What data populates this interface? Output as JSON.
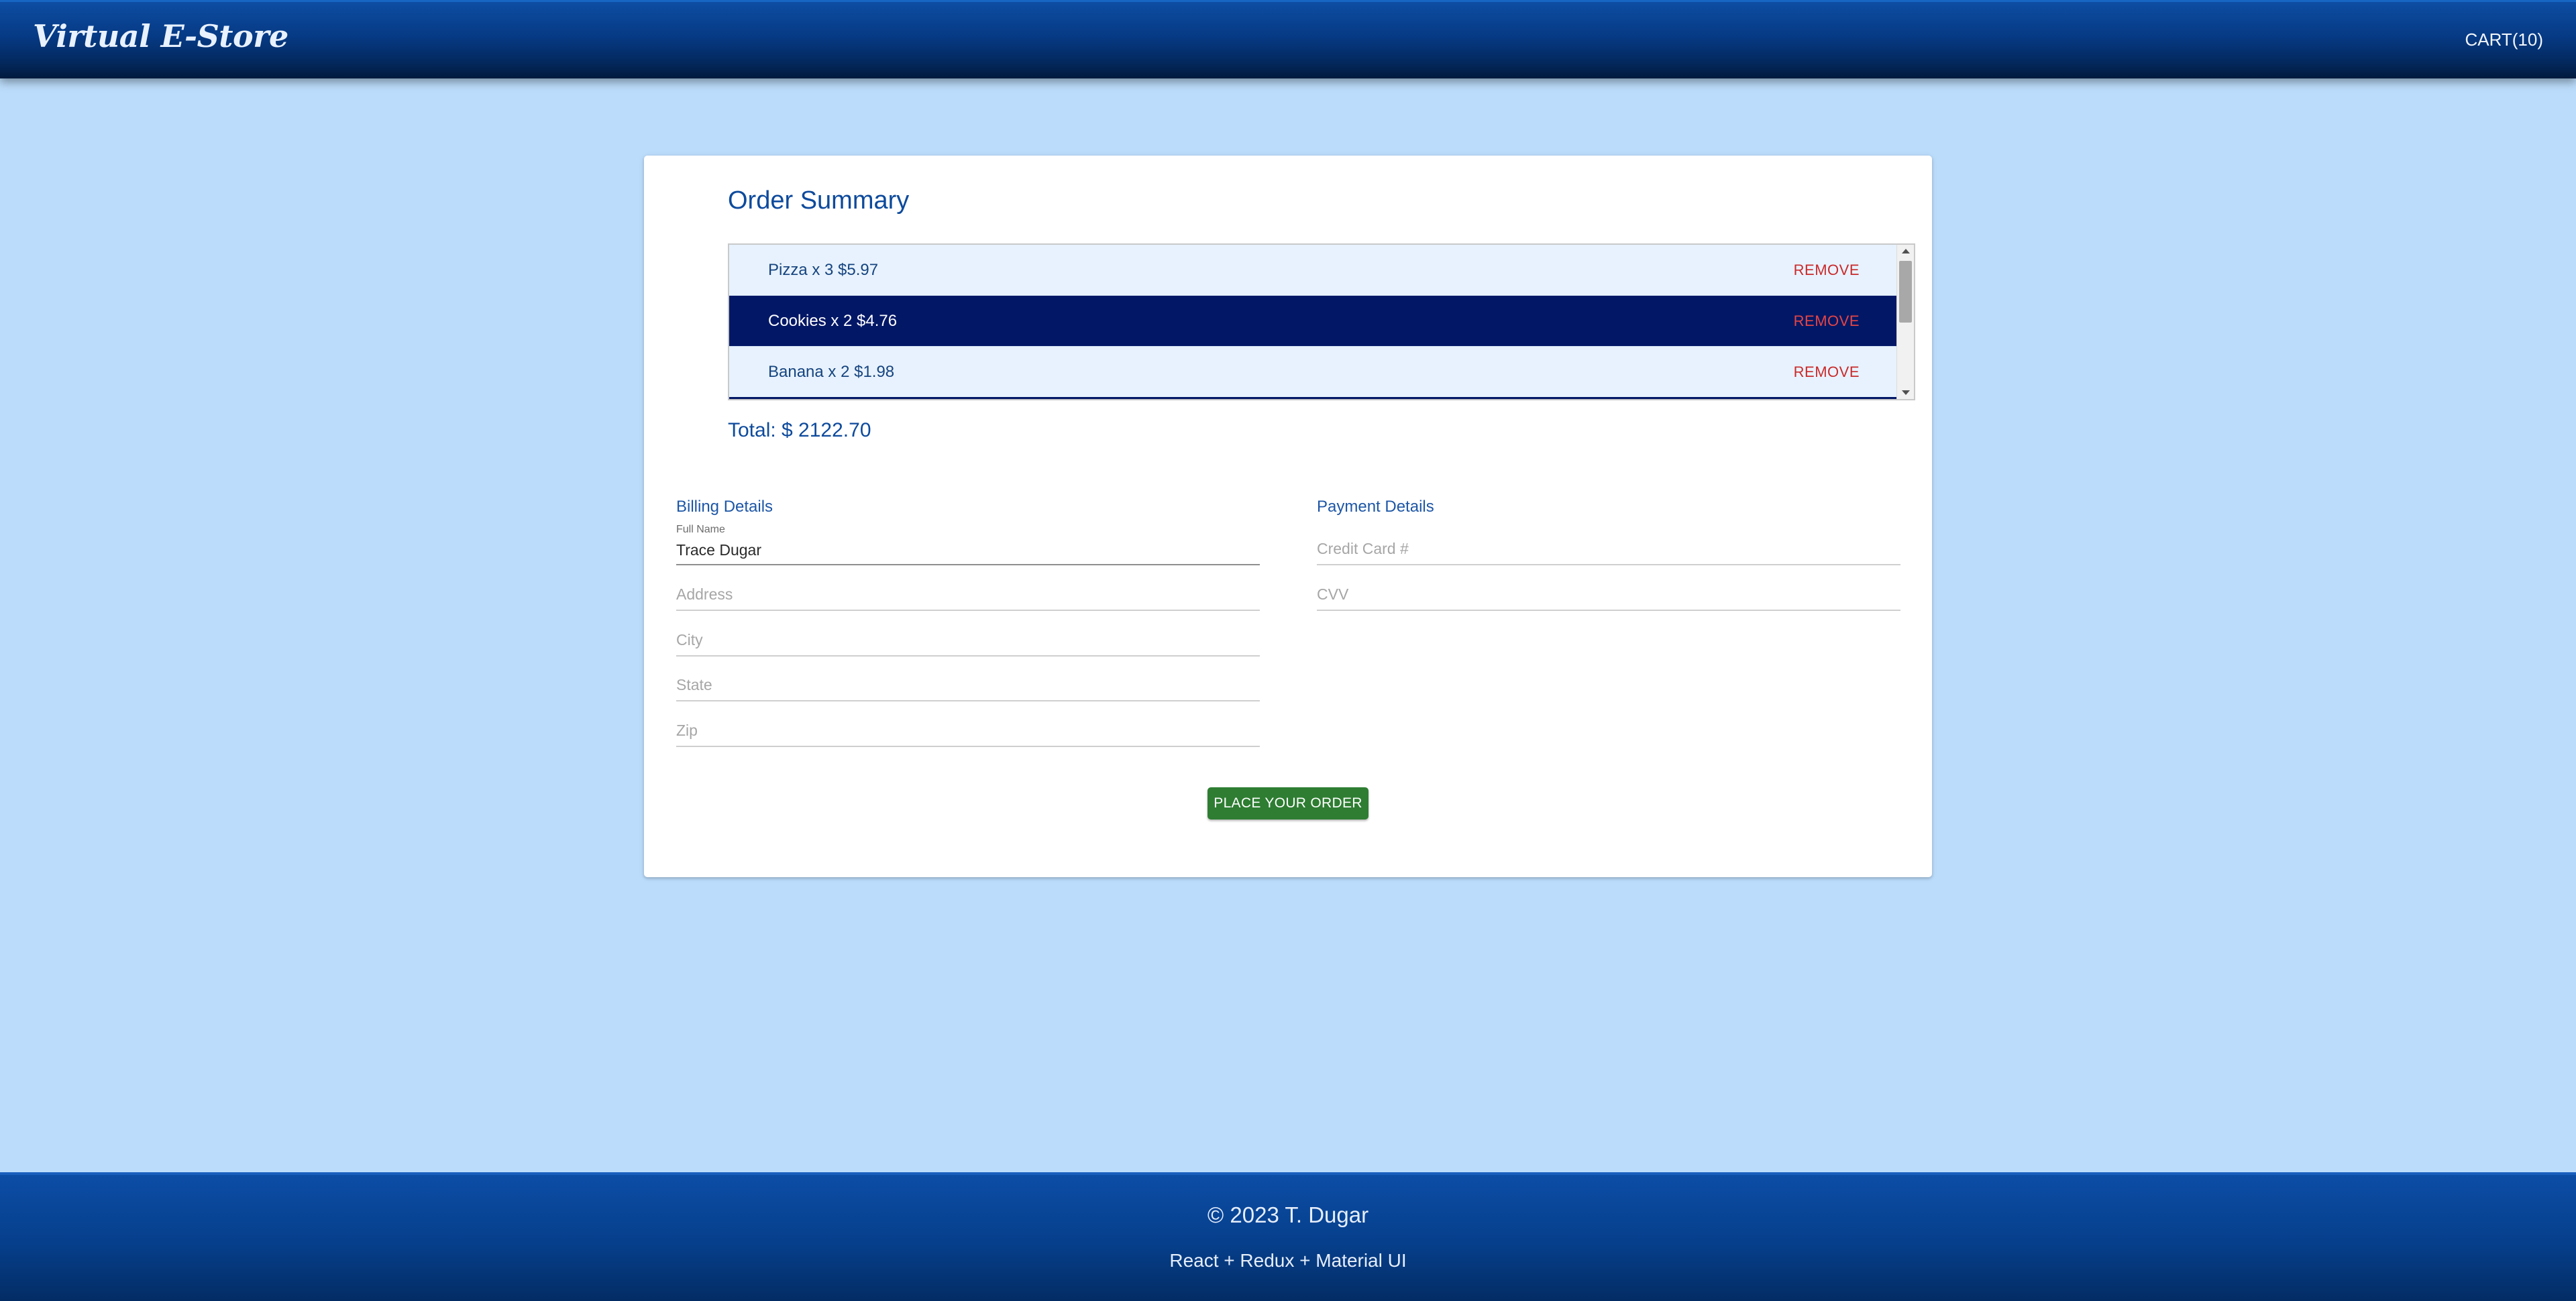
{
  "header": {
    "brand": "Virtual E-Store",
    "cart_label": "CART(10)"
  },
  "order_summary": {
    "title": "Order Summary",
    "remove_label": "REMOVE",
    "items": [
      {
        "label": "Pizza x 3 $5.97",
        "selected": false
      },
      {
        "label": "Cookies x 2 $4.76",
        "selected": true
      },
      {
        "label": "Banana x 2 $1.98",
        "selected": false
      }
    ],
    "total": "Total: $ 2122.70"
  },
  "billing": {
    "title": "Billing Details",
    "full_name_label": "Full Name",
    "full_name_value": "Trace Dugar",
    "address_placeholder": "Address",
    "city_placeholder": "City",
    "state_placeholder": "State",
    "zip_placeholder": "Zip"
  },
  "payment": {
    "title": "Payment Details",
    "card_placeholder": "Credit Card #",
    "cvv_placeholder": "CVV"
  },
  "actions": {
    "place_order_label": "PLACE YOUR ORDER"
  },
  "footer": {
    "copyright": "© 2023 T. Dugar",
    "stack": "React + Redux + Material UI"
  },
  "colors": {
    "page_background": "#bbdcfb",
    "header_blue": "#063a84",
    "accent_text": "#0d4a9c",
    "selected_row": "#021766",
    "remove_red": "#c92a2a",
    "order_green": "#2e7d32"
  }
}
